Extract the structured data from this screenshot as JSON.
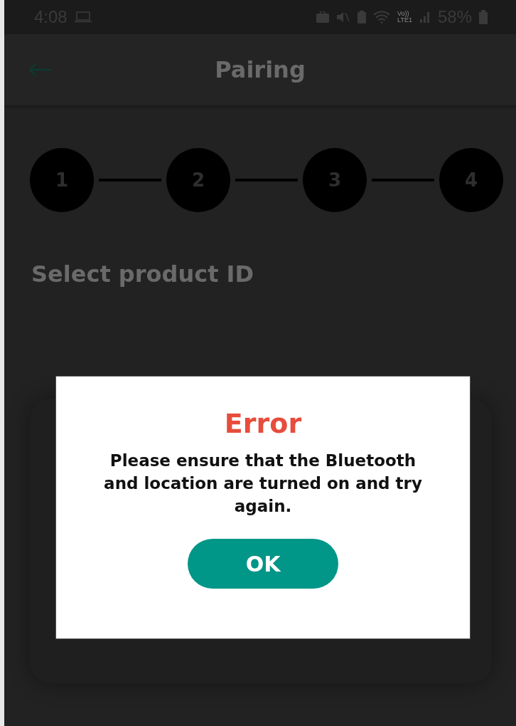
{
  "status_bar": {
    "time": "4:08",
    "network_label": [
      "Vo))",
      "LTE1"
    ],
    "battery": "58%"
  },
  "header": {
    "title": "Pairing"
  },
  "steps": [
    {
      "label": "1"
    },
    {
      "label": "2"
    },
    {
      "label": "3"
    },
    {
      "label": "4"
    }
  ],
  "heading": "Select product ID",
  "dialog": {
    "title": "Error",
    "message": "Please ensure that the Bluetooth and location are turned on and try again.",
    "button": "OK"
  }
}
